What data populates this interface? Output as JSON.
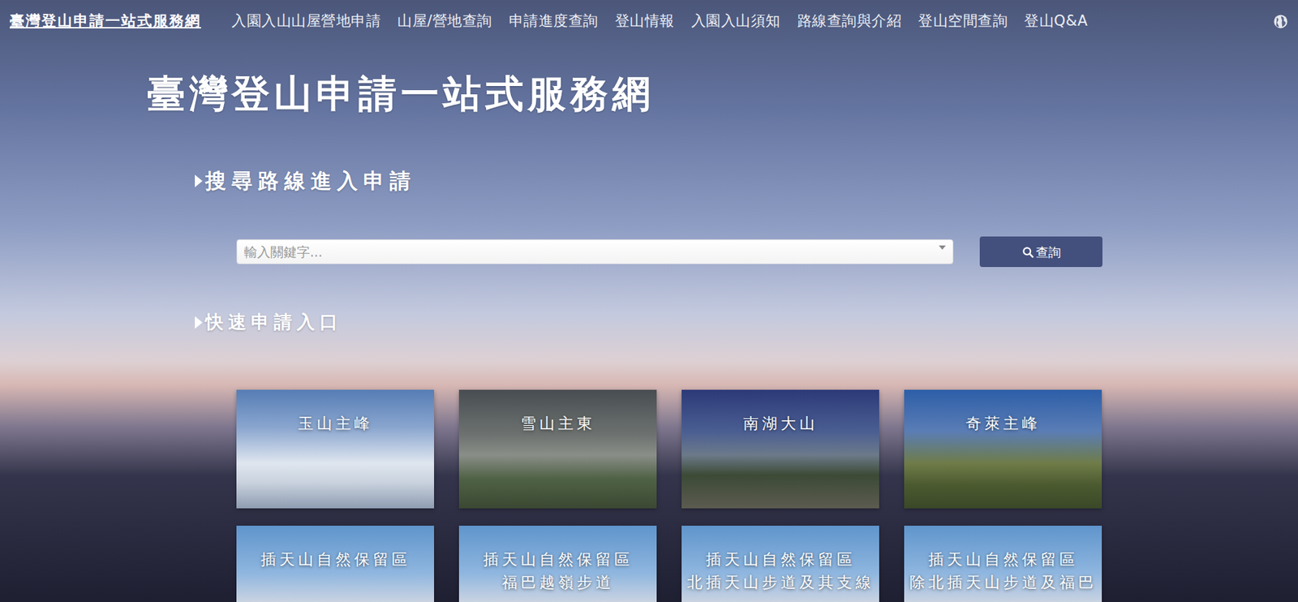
{
  "brand": "臺灣登山申請一站式服務網",
  "nav": [
    {
      "label": "入園入山山屋營地申請"
    },
    {
      "label": "山屋/營地查詢"
    },
    {
      "label": "申請進度查詢"
    },
    {
      "label": "登山情報"
    },
    {
      "label": "入園入山須知"
    },
    {
      "label": "路線查詢與介紹"
    },
    {
      "label": "登山空間查詢"
    },
    {
      "label": "登山Q&A"
    }
  ],
  "title": "臺灣登山申請一站式服務網",
  "search": {
    "heading": "搜尋路線進入申請",
    "placeholder": "輸入關鍵字...",
    "button": "查詢"
  },
  "quick": {
    "heading": "快速申請入口",
    "cards": [
      {
        "lines": [
          "玉山主峰"
        ]
      },
      {
        "lines": [
          "雪山主東"
        ]
      },
      {
        "lines": [
          "南湖大山"
        ]
      },
      {
        "lines": [
          "奇萊主峰"
        ]
      },
      {
        "lines": [
          "插天山自然保留區"
        ]
      },
      {
        "lines": [
          "插天山自然保留區",
          "福巴越嶺步道"
        ]
      },
      {
        "lines": [
          "插天山自然保留區",
          "北插天山步道及其支線"
        ]
      },
      {
        "lines": [
          "插天山自然保留區",
          "除北插天山步道及福巴"
        ]
      }
    ]
  }
}
